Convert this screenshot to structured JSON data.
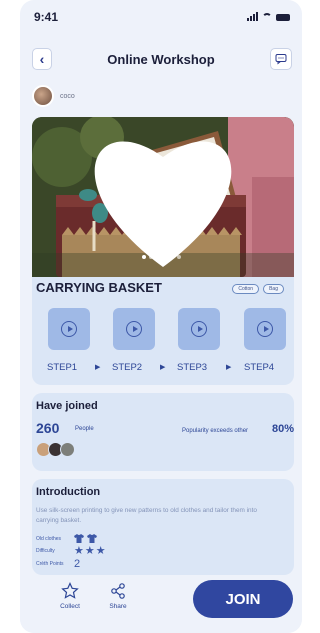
{
  "status_bar": {
    "time": "9:41"
  },
  "nav": {
    "title": "Online Workshop"
  },
  "author": {
    "name": "coco"
  },
  "hero": {
    "page_count": 6,
    "active_page": 1
  },
  "product": {
    "title": "CARRYING BASKET",
    "tags": [
      "Cotton",
      "Bag"
    ]
  },
  "steps": [
    "STEP1",
    "STEP2",
    "STEP3",
    "STEP4"
  ],
  "joined": {
    "title": "Have joined",
    "count": "260",
    "unit": "People",
    "popularity_label": "Popularity exceeds other",
    "popularity_value": "80%"
  },
  "intro": {
    "title": "Introduction",
    "text": "Use silk-screen printing to give new patterns to old clothes and tailor them into carrying basket.",
    "rows": [
      {
        "label": "Old clothes",
        "icon": "shirt-icon",
        "count": 2
      },
      {
        "label": "Difficulty",
        "icon": "star-icon",
        "count": 3
      },
      {
        "label": "Crèth Points",
        "value": "2"
      }
    ]
  },
  "bottom_bar": {
    "collect": "Collect",
    "share": "Share",
    "join": "JOIN"
  },
  "colors": {
    "accent": "#3047a0",
    "card": "#dbe6f6",
    "step_box": "#9fb9e6"
  }
}
